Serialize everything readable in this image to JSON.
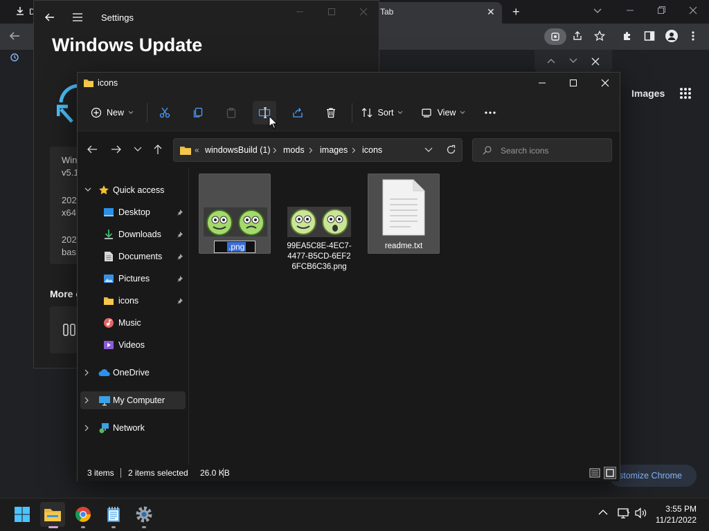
{
  "chrome": {
    "download_label": "D",
    "tab_label": "Tab",
    "images_link": "Images",
    "customize_label": "Customize Chrome",
    "customize_visible": "stomize Chrome"
  },
  "settings": {
    "title": "Settings",
    "heading": "Windows Update",
    "card_lines": [
      "Win",
      "v5.1",
      "202",
      "x64",
      "202",
      "bas"
    ],
    "more_label": "More o"
  },
  "explorer": {
    "title": "icons",
    "toolbar": {
      "new_label": "New",
      "sort_label": "Sort",
      "view_label": "View"
    },
    "address": {
      "prefix": "«",
      "crumbs": [
        "windowsBuild (1)",
        "mods",
        "images",
        "icons"
      ]
    },
    "search_placeholder": "Search icons",
    "nav": {
      "quick_access": "Quick access",
      "pinned": [
        "Desktop",
        "Downloads",
        "Documents",
        "Pictures",
        "icons"
      ],
      "others": [
        "Music",
        "Videos"
      ],
      "onedrive": "OneDrive",
      "my_computer": "My Computer",
      "network": "Network"
    },
    "files": [
      {
        "name": ".png",
        "renaming": true
      },
      {
        "name_lines": [
          "99EA5C8E-4EC7-",
          "4477-B5CD-6EF2",
          "6FCB6C36.png"
        ]
      },
      {
        "name": "readme.txt"
      }
    ],
    "status": {
      "items": "3 items",
      "selected": "2 items selected",
      "size": "26.0 KB"
    }
  },
  "taskbar": {
    "time": "3:55 PM",
    "date": "11/21/2022"
  },
  "colors": {
    "accent": "#3c6fd6",
    "folder": "#e8b740",
    "chrome_link": "#8ab4f8"
  }
}
